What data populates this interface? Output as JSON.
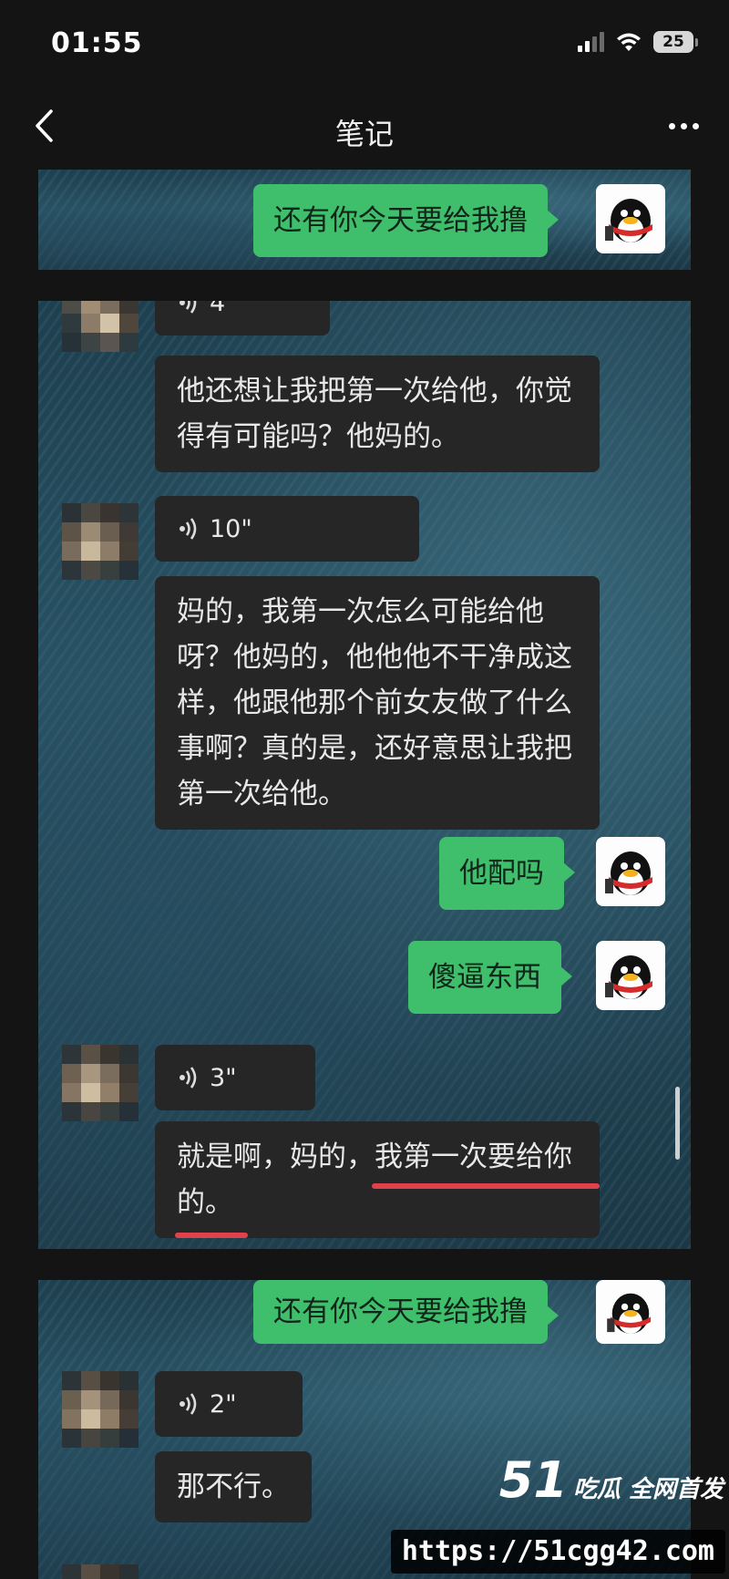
{
  "status_bar": {
    "time": "01:55",
    "battery": "25"
  },
  "nav": {
    "title": "笔记"
  },
  "colors": {
    "accent_green": "#3fbf6c",
    "bubble_dark": "#262626",
    "underline_red": "#e0414a"
  },
  "panel_1": {
    "messages": [
      {
        "side": "right",
        "type": "text",
        "text": "还有你今天要给我撸"
      }
    ]
  },
  "panel_2": {
    "messages": [
      {
        "side": "left",
        "type": "voice",
        "duration": "4\""
      },
      {
        "side": "left",
        "type": "text",
        "text": "他还想让我把第一次给他，你觉得有可能吗？他妈的。"
      },
      {
        "side": "left",
        "type": "voice",
        "duration": "10\""
      },
      {
        "side": "left",
        "type": "text",
        "text": "妈的，我第一次怎么可能给他呀？他妈的，他他他不干净成这样，他跟他那个前女友做了什么事啊？真的是，还好意思让我把第一次给他。"
      },
      {
        "side": "right",
        "type": "text",
        "text": "他配吗"
      },
      {
        "side": "right",
        "type": "text",
        "text": "傻逼东西"
      },
      {
        "side": "left",
        "type": "voice",
        "duration": "3\""
      },
      {
        "side": "left",
        "type": "text",
        "text": "就是啊，妈的，我第一次要给你的。"
      }
    ]
  },
  "panel_3": {
    "messages": [
      {
        "side": "right",
        "type": "text",
        "text": "还有你今天要给我撸"
      },
      {
        "side": "left",
        "type": "voice",
        "duration": "2\""
      },
      {
        "side": "left",
        "type": "text",
        "text": "那不行。"
      }
    ]
  },
  "watermark": {
    "logo": "51",
    "tagline": "吃瓜 全网首发",
    "url": "https://51cgg42.com"
  }
}
